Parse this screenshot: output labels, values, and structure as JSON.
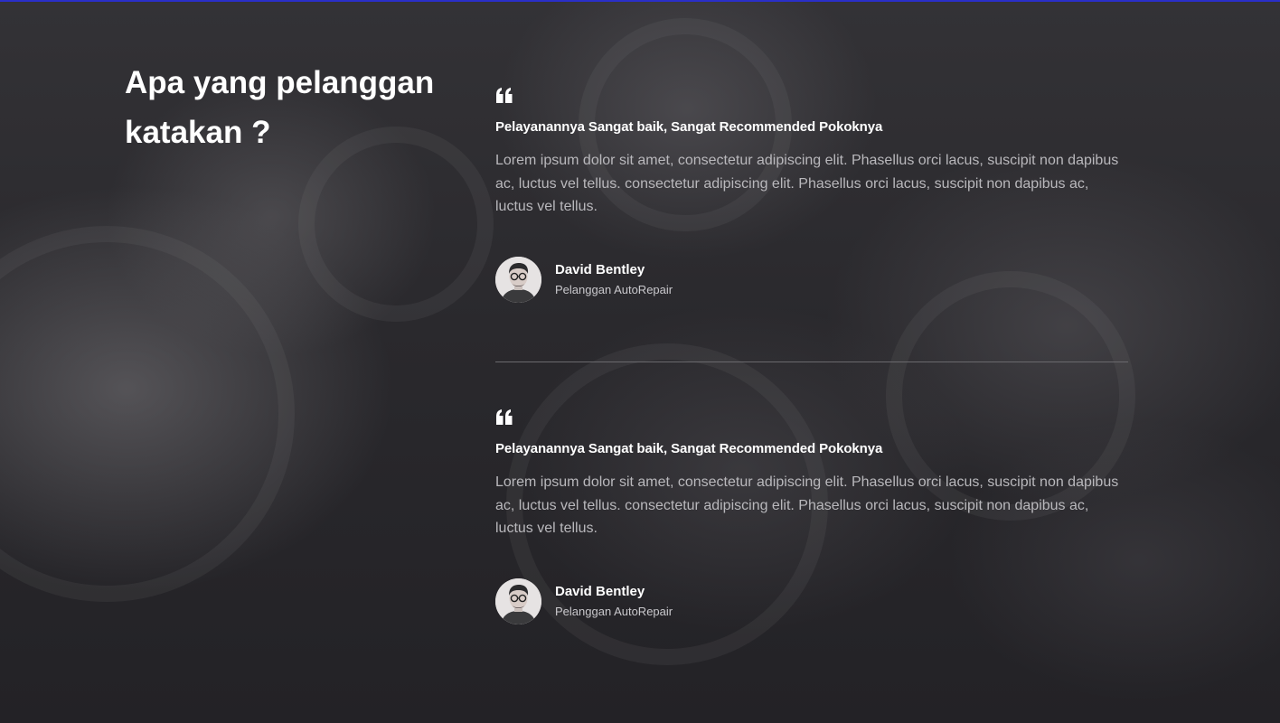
{
  "section": {
    "heading": "Apa yang pelanggan katakan ?"
  },
  "testimonials": [
    {
      "icon": "quote-icon",
      "title": "Pelayanannya Sangat baik, Sangat Recommended Pokoknya",
      "text": "Lorem ipsum dolor sit amet, consectetur adipiscing elit. Phasellus orci lacus, suscipit non dapibus ac, luctus vel tellus. consectetur adipiscing elit. Phasellus orci lacus, suscipit non dapibus ac, luctus vel tellus.",
      "author_name": "David Bentley",
      "author_role": "Pelanggan AutoRepair"
    },
    {
      "icon": "quote-icon",
      "title": "Pelayanannya Sangat baik, Sangat Recommended Pokoknya",
      "text": "Lorem ipsum dolor sit amet, consectetur adipiscing elit. Phasellus orci lacus, suscipit non dapibus ac, luctus vel tellus. consectetur adipiscing elit. Phasellus orci lacus, suscipit non dapibus ac, luctus vel tellus.",
      "author_name": "David Bentley",
      "author_role": "Pelanggan AutoRepair"
    }
  ],
  "colors": {
    "accent_bar": "#2a2fc9",
    "background": "#2a292d",
    "heading": "#ffffff",
    "body_text": "#b9b8bc"
  }
}
